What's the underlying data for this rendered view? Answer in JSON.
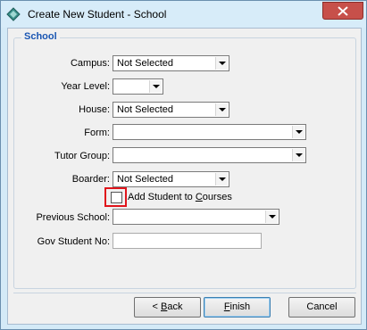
{
  "window": {
    "title": "Create New Student - School"
  },
  "group": {
    "title": "School"
  },
  "fields": {
    "campus": {
      "label": "Campus:",
      "value": "Not Selected"
    },
    "year_level": {
      "label": "Year Level:",
      "value": ""
    },
    "house": {
      "label": "House:",
      "value": "Not Selected"
    },
    "form": {
      "label": "Form:",
      "value": ""
    },
    "tutor_group": {
      "label": "Tutor Group:",
      "value": ""
    },
    "boarder": {
      "label": "Boarder:",
      "value": "Not Selected"
    },
    "add_to_courses": {
      "label_pre": "Add Student to ",
      "label_u": "C",
      "label_post": "ourses",
      "checked": false
    },
    "previous_school": {
      "label": "Previous School:",
      "value": ""
    },
    "gov_student_no": {
      "label": "Gov Student No:",
      "value": ""
    }
  },
  "buttons": {
    "back": {
      "pre": "< ",
      "u": "B",
      "post": "ack"
    },
    "finish": {
      "pre": "",
      "u": "F",
      "post": "inish"
    },
    "cancel": {
      "label": "Cancel"
    }
  },
  "colors": {
    "highlight": "#e0141b",
    "group_title": "#1a56b3"
  }
}
